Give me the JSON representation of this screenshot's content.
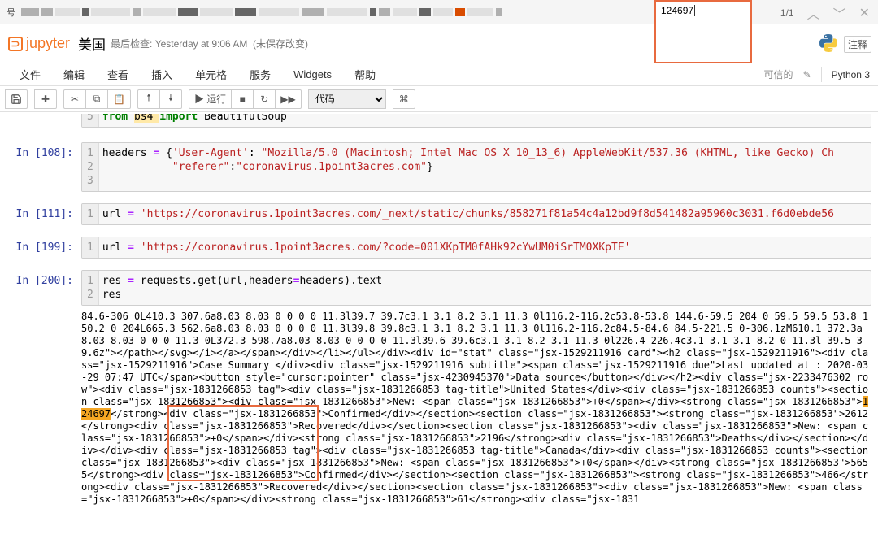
{
  "tabs": {
    "prefix_label": "号"
  },
  "search": {
    "value": "124697",
    "count": "1/1"
  },
  "header": {
    "logo": "jupyter",
    "nb_name": "美国",
    "last_checkpoint_label": "最后检查:",
    "last_checkpoint_time": "Yesterday at 9:06 AM",
    "unsaved": "(未保存改变)",
    "comment_btn": "注释"
  },
  "menubar": {
    "items": [
      "文件",
      "编辑",
      "查看",
      "插入",
      "单元格",
      "服务",
      "Widgets",
      "帮助"
    ],
    "trusted": "可信的",
    "kernel": "Python 3"
  },
  "toolbar": {
    "run_label": "▶ 运行",
    "cell_type": "代码"
  },
  "cells": [
    {
      "prompt": "",
      "gutter": [
        "5"
      ],
      "tokens": [
        {
          "t": "from ",
          "c": "kw"
        },
        {
          "t": "bs4 ",
          "c": "name hl-str"
        },
        {
          "t": "import",
          "c": "kw"
        },
        {
          "t": " BeautifulSoup",
          "c": "name"
        }
      ]
    },
    {
      "prompt": "In [108]:",
      "gutter": [
        "1",
        "2",
        "3"
      ],
      "line1_pre": "headers ",
      "line1_eq": "=",
      "line1_brace": " {",
      "line1_k1": "'User-Agent'",
      "line1_colon": ": ",
      "line1_v1": "\"Mozilla/5.0 (Macintosh; Intel Mac OS X 10_13_6) AppleWebKit/537.36 (KHTML, like Gecko) Ch",
      "line2_indent": "           ",
      "line2_k": "\"referer\"",
      "line2_colon": ":",
      "line2_v": "\"coronavirus.1point3acres.com\"",
      "line2_brace": "}"
    },
    {
      "prompt": "In [111]:",
      "gutter": [
        "1"
      ],
      "var": "url ",
      "eq": "=",
      "sp": " ",
      "val": "'https://coronavirus.1point3acres.com/_next/static/chunks/858271f81a54c4a12bd9f8d541482a95960c3031.f6d0ebde56"
    },
    {
      "prompt": "In [199]:",
      "gutter": [
        "1"
      ],
      "var": "url ",
      "eq": "=",
      "sp": " ",
      "val": "'https://coronavirus.1point3acres.com/?code=001XKpTM0fAHk92cYwUM0iSrTM0XKpTF'"
    },
    {
      "prompt": "In [200]:",
      "gutter": [
        "1",
        "2"
      ],
      "line1": "res ",
      "line1_eq": "=",
      "line1_rest": " requests.get(url,headers",
      "line1_eq2": "=",
      "line1_rest2": "headers).text",
      "line2": "res"
    }
  ],
  "output_text_pre": "84.6-306 0L410.3 307.6a8.03 8.03 0 0 0 0 11.3l39.7 39.7c3.1 3.1 8.2 3.1 11.3 0l116.2-116.2c53.8-53.8 144.6-59.5 204 0 59.5 59.5 53.8 150.2 0 204L665.3 562.6a8.03 8.03 0 0 0 0 11.3l39.8 39.8c3.1 3.1 8.2 3.1 11.3 0l116.2-116.2c84.5-84.6 84.5-221.5 0-306.1zM610.1 372.3a8.03 8.03 0 0 0-11.3 0L372.3 598.7a8.03 8.03 0 0 0 0 11.3l39.6 39.6c3.1 3.1 8.2 3.1 11.3 0l226.4-226.4c3.1-3.1 3.1-8.2 0-11.3l-39.5-39.6z\"></path></svg></i></a></span></div></li></ul></div><div id=\"stat\" class=\"jsx-1529211916 card\"><h2 class=\"jsx-1529211916\"><div class=\"jsx-1529211916\">Case Summary </div><div class=\"jsx-1529211916 subtitle\"><span class=\"jsx-1529211916 due\">Last updated at : 2020-03-29 07:47 UTC</span><button style=\"cursor:pointer\" class=\"jsx-4230945370\">Data source</button></div></h2><div class=\"jsx-2233476302 row\"><div class=\"jsx-1831266853 tag\"><div class=\"jsx-1831266853 tag-title\">United States</div><div class=\"jsx-1831266853 counts\"><section class=\"jsx-1831266853\"><div class=\"jsx-1831266853\">New: <span class=\"jsx-1831266853\">+0</span></div><strong class=\"jsx-1831266853\">",
  "output_hl": "124697",
  "output_text_post": "</strong><div class=\"jsx-1831266853\">Confirmed</div></section><section class=\"jsx-1831266853\"><strong class=\"jsx-1831266853\">2612</strong><div class=\"jsx-1831266853\">Recovered</div></section><section class=\"jsx-1831266853\"><div class=\"jsx-1831266853\">New: <span class=\"jsx-1831266853\">+0</span></div><strong class=\"jsx-1831266853\">2196</strong><div class=\"jsx-1831266853\">Deaths</div></section></div></div><div class=\"jsx-1831266853 tag\"><div class=\"jsx-1831266853 tag-title\">Canada</div><div class=\"jsx-1831266853 counts\"><section class=\"jsx-1831266853\"><div class=\"jsx-1831266853\">New: <span class=\"jsx-1831266853\">+0</span></div><strong class=\"jsx-1831266853\">5655</strong><div class=\"jsx-1831266853\">Confirmed</div></section><section class=\"jsx-1831266853\"><strong class=\"jsx-1831266853\">466</strong><div class=\"jsx-1831266853\">Recovered</div></section><section class=\"jsx-1831266853\"><div class=\"jsx-1831266853\">New: <span class=\"jsx-1831266853\">+0</span></div><strong class=\"jsx-1831266853\">61</strong><div class=\"jsx-1831"
}
